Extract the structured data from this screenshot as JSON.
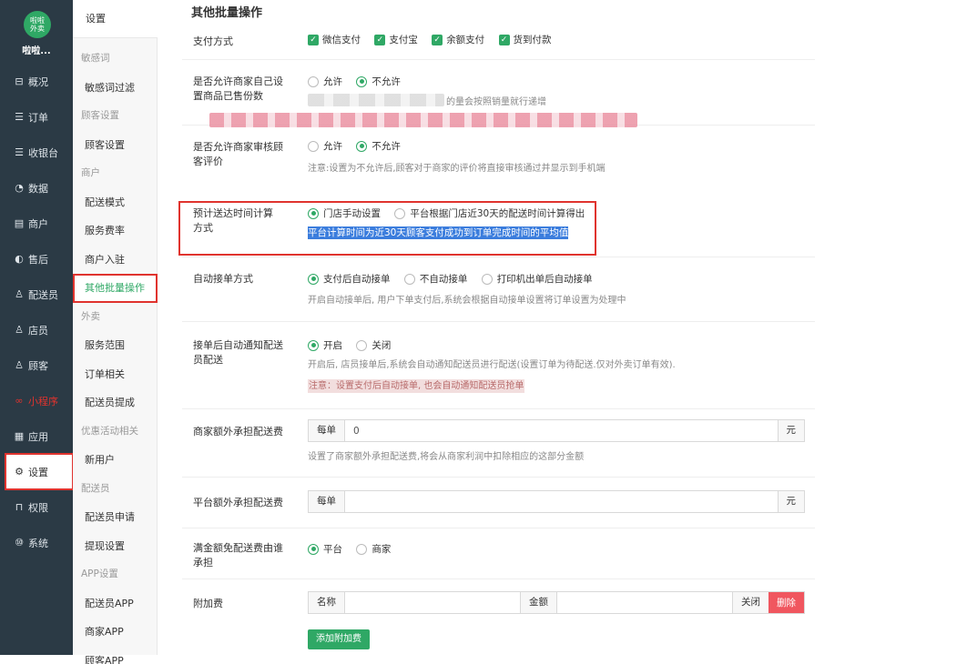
{
  "sidebar": {
    "logo_text": "啦啦\n外卖",
    "app_name": "啦啦...",
    "items": [
      {
        "label": "概况",
        "icon": "dashboard-icon",
        "glyph": "⊟"
      },
      {
        "label": "订单",
        "icon": "order-icon",
        "glyph": "☰"
      },
      {
        "label": "收银台",
        "icon": "cashier-icon",
        "glyph": "☰"
      },
      {
        "label": "数据",
        "icon": "data-icon",
        "glyph": "◔"
      },
      {
        "label": "商户",
        "icon": "store-icon",
        "glyph": "▤"
      },
      {
        "label": "售后",
        "icon": "aftersale-icon",
        "glyph": "◐"
      },
      {
        "label": "配送员",
        "icon": "courier-icon",
        "glyph": "♙"
      },
      {
        "label": "店员",
        "icon": "clerk-icon",
        "glyph": "♙"
      },
      {
        "label": "顾客",
        "icon": "customer-icon",
        "glyph": "♙"
      },
      {
        "label": "小程序",
        "icon": "miniprogram-icon",
        "glyph": "∞"
      },
      {
        "label": "应用",
        "icon": "apps-icon",
        "glyph": "▦"
      },
      {
        "label": "设置",
        "icon": "gear-icon",
        "glyph": "⚙"
      },
      {
        "label": "权限",
        "icon": "lock-icon",
        "glyph": "⊓"
      },
      {
        "label": "系统",
        "icon": "system-icon",
        "glyph": "⑩"
      }
    ]
  },
  "submenu": {
    "title": "设置",
    "items": [
      {
        "label": "敏感词",
        "group": true
      },
      {
        "label": "敏感词过滤"
      },
      {
        "label": "顾客设置",
        "group": true
      },
      {
        "label": "顾客设置"
      },
      {
        "label": "商户",
        "group": true
      },
      {
        "label": "配送模式"
      },
      {
        "label": "服务费率"
      },
      {
        "label": "商户入驻"
      },
      {
        "label": "其他批量操作",
        "active": true
      },
      {
        "label": "外卖",
        "group": true
      },
      {
        "label": "服务范围"
      },
      {
        "label": "订单相关"
      },
      {
        "label": "配送员提成"
      },
      {
        "label": "优惠活动相关",
        "group": true
      },
      {
        "label": "新用户"
      },
      {
        "label": "配送员",
        "group": true
      },
      {
        "label": "配送员申请"
      },
      {
        "label": "提现设置"
      },
      {
        "label": "APP设置",
        "group": true
      },
      {
        "label": "配送员APP"
      },
      {
        "label": "商家APP"
      },
      {
        "label": "顾客APP"
      }
    ]
  },
  "main": {
    "title": "其他批量操作",
    "payment": {
      "label": "支付方式",
      "options": [
        "微信支付",
        "支付宝",
        "余额支付",
        "货到付款"
      ]
    },
    "sold_count": {
      "label": "是否允许商家自己设置商品已售份数",
      "allow": "允许",
      "deny": "不允许",
      "help_tail": "的量会按照销量就行递增"
    },
    "review": {
      "label": "是否允许商家审核顾客评价",
      "allow": "允许",
      "deny": "不允许",
      "help": "注意:设置为不允许后,顾客对于商家的评价将直接审核通过并显示到手机端"
    },
    "eta": {
      "label": "预计送达时间计算方式",
      "opt_manual": "门店手动设置",
      "opt_platform": "平台根据门店近30天的配送时间计算得出",
      "help": "平台计算时间为近30天顾客支付成功到订单完成时间的平均值"
    },
    "auto_accept": {
      "label": "自动接单方式",
      "options": [
        "支付后自动接单",
        "不自动接单",
        "打印机出单后自动接单"
      ],
      "help": "开启自动接单后, 用户下单支付后,系统会根据自动接单设置将订单设置为处理中"
    },
    "notify": {
      "label": "接单后自动通知配送员配送",
      "on": "开启",
      "off": "关闭",
      "help": "开启后, 店员接单后,系统会自动通知配送员进行配送(设置订单为待配送.仅对外卖订单有效).",
      "warn": "注意：设置支付后自动接单, 也会自动通知配送员抢单"
    },
    "merchant_fee": {
      "label": "商家额外承担配送费",
      "prefix": "每单",
      "value": "0",
      "suffix": "元",
      "help": "设置了商家额外承担配送费,将会从商家利润中扣除相应的这部分金额"
    },
    "platform_fee": {
      "label": "平台额外承担配送费",
      "prefix": "每单",
      "value": "",
      "suffix": "元"
    },
    "free_bearer": {
      "label": "满金额免配送费由谁承担",
      "opt_platform": "平台",
      "opt_merchant": "商家"
    },
    "surcharge": {
      "label": "附加费",
      "name_label": "名称",
      "amount_label": "金额",
      "close": "关闭",
      "delete": "删除",
      "add": "添加附加费"
    }
  }
}
